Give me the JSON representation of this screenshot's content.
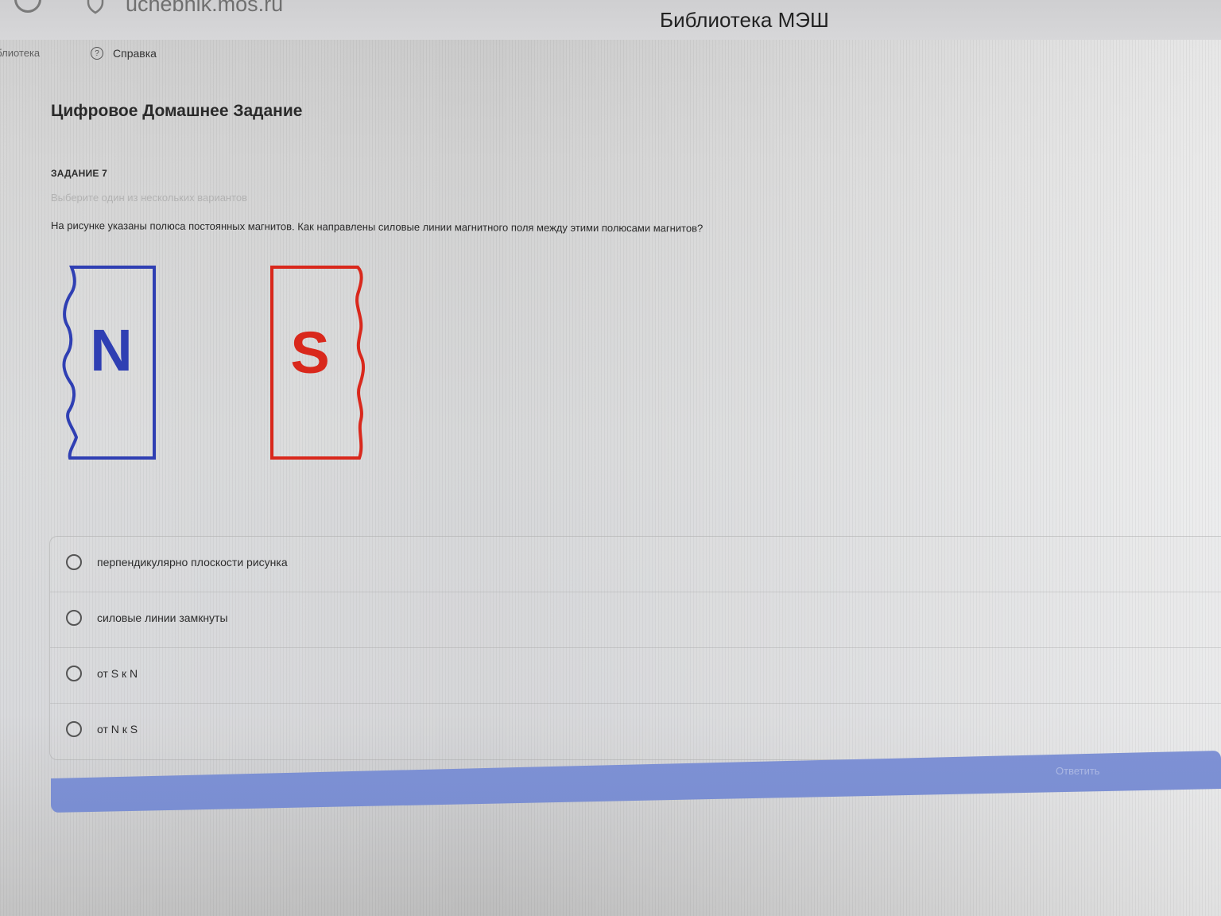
{
  "browser": {
    "domain": "uchebnik.mos.ru",
    "tab_title": "Библиотека МЭШ"
  },
  "nav": {
    "library": "иблиотека",
    "help": "Справка"
  },
  "page": {
    "title": "Цифровое Домашнее Задание",
    "task_label": "ЗАДАНИЕ 7",
    "instruction": "Выберите один из нескольких вариантов",
    "question": "На рисунке указаны полюса постоянных магнитов. Как направлены силовые линии магнитного поля между этими полюсами магнитов?"
  },
  "figure": {
    "north_label": "N",
    "south_label": "S",
    "north_color": "#2f3fb3",
    "south_color": "#d9281c"
  },
  "options": [
    {
      "label": "перпендикулярно плоскости рисунка"
    },
    {
      "label": "силовые линии замкнуты"
    },
    {
      "label": "от S к N"
    },
    {
      "label": "от N к S"
    }
  ],
  "submit": {
    "label": "Ответить",
    "color": "#7b8fd3"
  }
}
